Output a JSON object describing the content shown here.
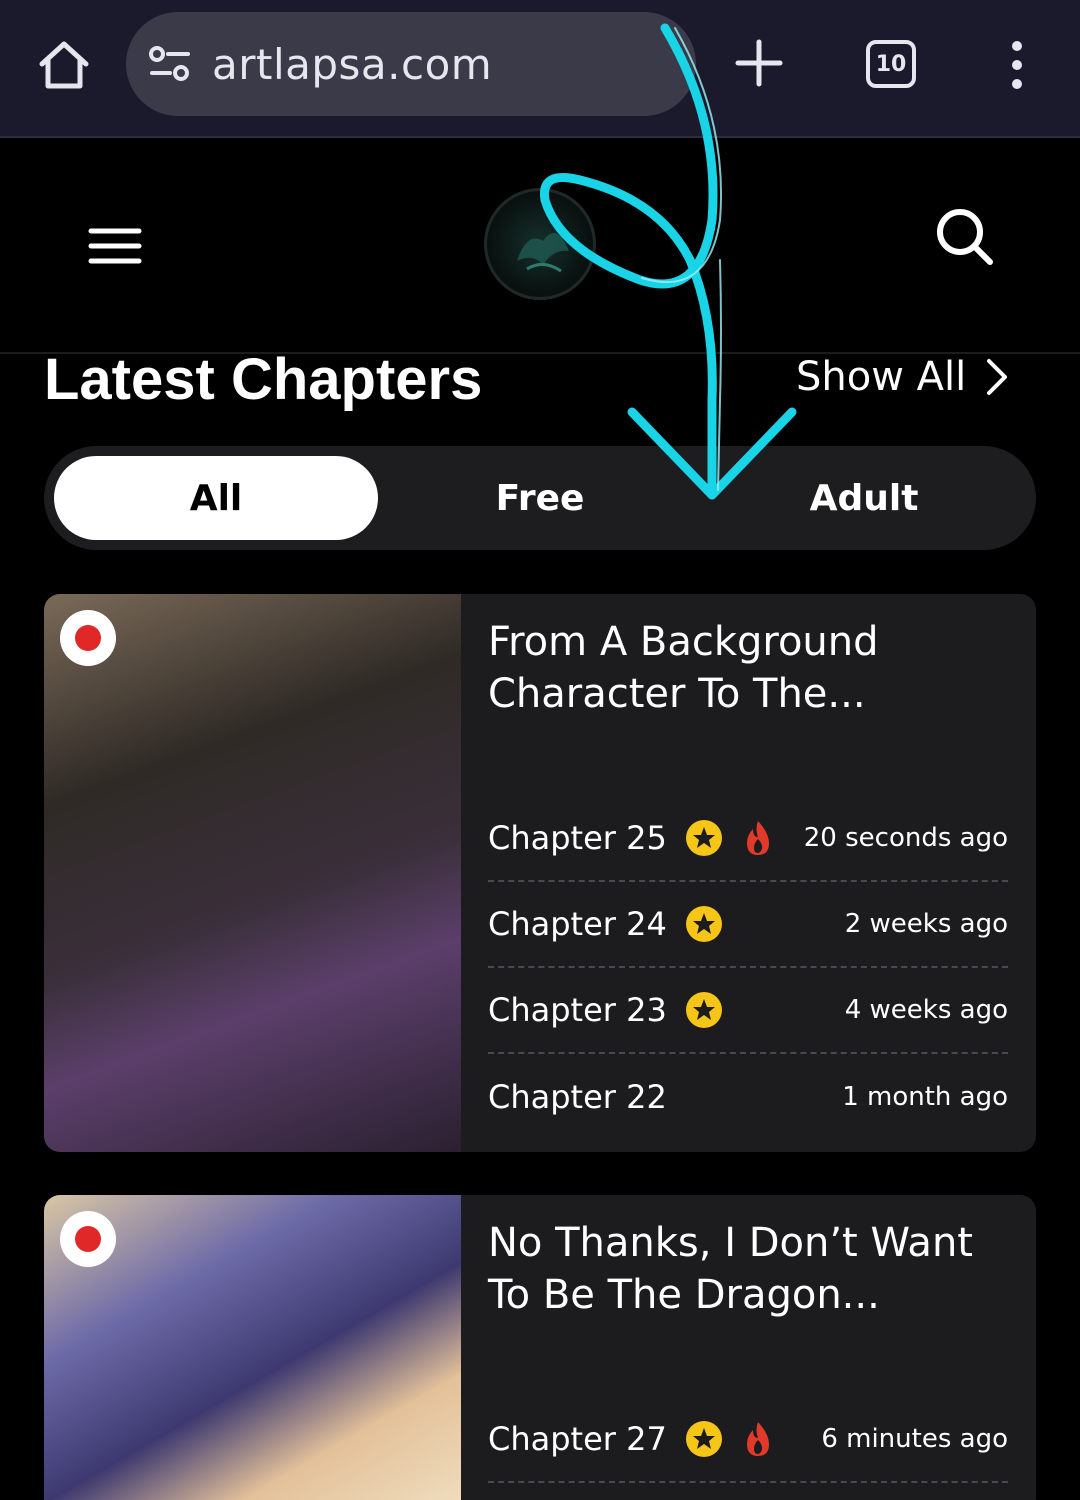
{
  "browser": {
    "url": "artlapsa.com",
    "tab_count": "10"
  },
  "section": {
    "title": "Latest Chapters",
    "show_all": "Show All"
  },
  "filters": {
    "all": "All",
    "free": "Free",
    "adult": "Adult",
    "selected": "All"
  },
  "cards": [
    {
      "title": "From A Background Character To The...",
      "chapters": [
        {
          "label": "Chapter 25",
          "time": "20 seconds ago",
          "star": true,
          "fire": true
        },
        {
          "label": "Chapter 24",
          "time": "2 weeks ago",
          "star": true,
          "fire": false
        },
        {
          "label": "Chapter 23",
          "time": "4 weeks ago",
          "star": true,
          "fire": false
        },
        {
          "label": "Chapter 22",
          "time": "1 month ago",
          "star": false,
          "fire": false
        }
      ]
    },
    {
      "title": "No Thanks, I Don’t Want To Be The Dragon...",
      "chapters": [
        {
          "label": "Chapter 27",
          "time": "6 minutes ago",
          "star": true,
          "fire": true
        }
      ]
    }
  ],
  "colors": {
    "browser_bar": "#1b1a2c",
    "card_bg": "#1c1c1e",
    "star": "#f5c518",
    "fire": "#e23a2a",
    "live_dot": "#e02828",
    "annotation": "#19d3e6"
  },
  "icons": [
    "home-icon",
    "tune-icon",
    "plus-icon",
    "tabs-icon",
    "more-vert-icon",
    "hamburger-icon",
    "search-icon",
    "chevron-right-icon",
    "star-icon",
    "fire-icon"
  ]
}
